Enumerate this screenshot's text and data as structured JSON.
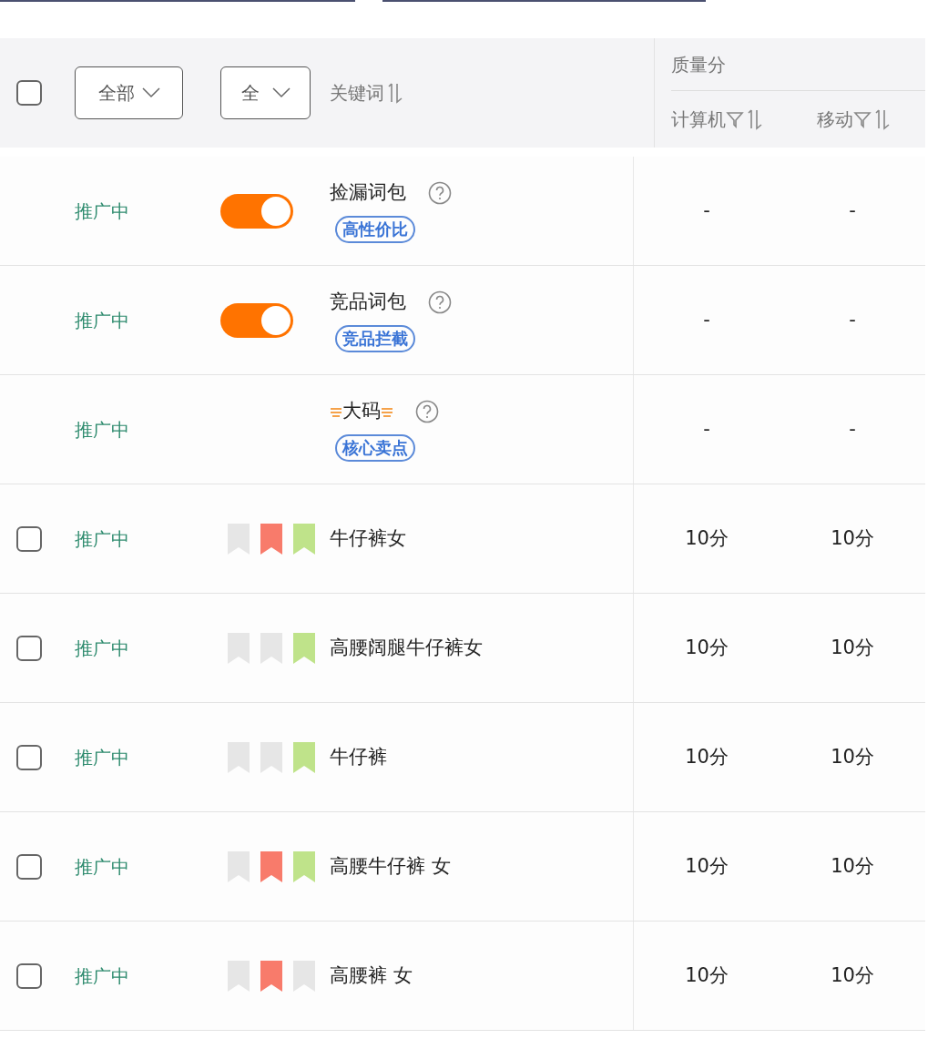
{
  "header": {
    "checked": false,
    "status_filter": "全部",
    "type_filter": "全",
    "keyword_label": "关键词",
    "quality_label": "质量分",
    "pc_label": "计算机",
    "mobile_label": "移动"
  },
  "rows": [
    {
      "kind": "package",
      "status": "推广中",
      "on": true,
      "name": "捡漏词包",
      "tag": "高性价比",
      "hot": false,
      "pc": "-",
      "mobile": "-"
    },
    {
      "kind": "package",
      "status": "推广中",
      "on": true,
      "name": "竞品词包",
      "tag": "竞品拦截",
      "hot": false,
      "pc": "-",
      "mobile": "-"
    },
    {
      "kind": "package",
      "status": "推广中",
      "name": "大码",
      "tag": "核心卖点",
      "hot": true,
      "pc": "-",
      "mobile": "-"
    },
    {
      "kind": "keyword",
      "status": "推广中",
      "checked": false,
      "flags": [
        {
          "color": "#e6e6e6"
        },
        {
          "color": "#f87b6b"
        },
        {
          "color": "#bfe38a"
        }
      ],
      "name": "牛仔裤女",
      "pc": "10分",
      "mobile": "10分"
    },
    {
      "kind": "keyword",
      "status": "推广中",
      "checked": false,
      "flags": [
        {
          "color": "#e6e6e6"
        },
        {
          "color": "#e6e6e6"
        },
        {
          "color": "#bfe38a"
        }
      ],
      "name": "高腰阔腿牛仔裤女",
      "pc": "10分",
      "mobile": "10分"
    },
    {
      "kind": "keyword",
      "status": "推广中",
      "checked": false,
      "flags": [
        {
          "color": "#e6e6e6"
        },
        {
          "color": "#e6e6e6"
        },
        {
          "color": "#bfe38a"
        }
      ],
      "name": "牛仔裤",
      "pc": "10分",
      "mobile": "10分"
    },
    {
      "kind": "keyword",
      "status": "推广中",
      "checked": false,
      "flags": [
        {
          "color": "#e6e6e6"
        },
        {
          "color": "#f87b6b"
        },
        {
          "color": "#bfe38a"
        }
      ],
      "name": "高腰牛仔裤 女",
      "pc": "10分",
      "mobile": "10分"
    },
    {
      "kind": "keyword",
      "status": "推广中",
      "checked": false,
      "flags": [
        {
          "color": "#e6e6e6"
        },
        {
          "color": "#f87b6b"
        },
        {
          "color": "#e6e6e6"
        }
      ],
      "name": "高腰裤 女",
      "pc": "10分",
      "mobile": "10分"
    }
  ]
}
